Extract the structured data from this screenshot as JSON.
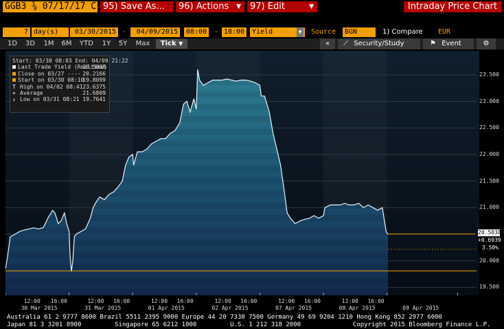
{
  "header": {
    "ticker": "GGB3 ⅜ 07/17/17 C",
    "save_label": "95) Save As...",
    "actions_label": "96) Actions",
    "edit_label": "97) Edit",
    "title": "Intraday Price Chart"
  },
  "params": {
    "period_value": "7",
    "period_unit": "day(s)",
    "start_date": "03/30/2015",
    "dash": "-",
    "end_date": "04/09/2015",
    "start_time": "08:00",
    "dash2": "-",
    "end_time": "18:00",
    "field": "Yield",
    "source_label": "Source",
    "source": "BGN",
    "compare_label": "1) Compare",
    "currency": "EUR"
  },
  "toolbar": {
    "tabs": [
      "1D",
      "3D",
      "1M",
      "6M",
      "YTD",
      "1Y",
      "5Y",
      "Max",
      "Tick"
    ],
    "active_tab": "Tick",
    "collapse": "«",
    "security_study": "Security/Study",
    "event": "Event",
    "settings_icon": "gear-icon"
  },
  "legend": {
    "header": "Start: 03/30 08:03 End: 04/09 21:22",
    "rows": [
      {
        "label": "Last Trade Yield (Realtime)",
        "value": "20.5038",
        "color": "#ffffff"
      },
      {
        "label": "Close on 03/27 ----",
        "value": "20.2166",
        "color": "#f2a000"
      },
      {
        "label": "Start on 03/30 08:10",
        "value": "19.8099",
        "color": "#f2a000"
      },
      {
        "label": "High on 04/02 08:41",
        "value": "23.6375",
        "color": "#ffffff"
      },
      {
        "label": "Average",
        "value": "21.6809",
        "color": "#ffffff"
      },
      {
        "label": "Low on 03/31 08:21",
        "value": "19.7641",
        "color": "#ffffff"
      }
    ]
  },
  "price_tags": {
    "last": "20.5038",
    "change": "+0.6939",
    "pct": "3.50%"
  },
  "chart_data": {
    "type": "area",
    "y_ticks": [
      19.5,
      20.0,
      20.5,
      21.0,
      21.5,
      22.0,
      22.5,
      23.0,
      23.5
    ],
    "y_tick_labels": [
      "19.500",
      "20.000",
      "20.500",
      "21.000",
      "21.500",
      "22.000",
      "22.500",
      "23.000",
      "23.500"
    ],
    "ylim": [
      19.35,
      23.95
    ],
    "x_time_labels": [
      {
        "pos": 0.055,
        "text": "12:00"
      },
      {
        "pos": 0.112,
        "text": "16:00"
      },
      {
        "pos": 0.19,
        "text": "12:00"
      },
      {
        "pos": 0.245,
        "text": "16:00"
      },
      {
        "pos": 0.325,
        "text": "12:00"
      },
      {
        "pos": 0.38,
        "text": "16:00"
      },
      {
        "pos": 0.46,
        "text": "12:00"
      },
      {
        "pos": 0.515,
        "text": "16:00"
      },
      {
        "pos": 0.595,
        "text": "12:00"
      },
      {
        "pos": 0.65,
        "text": "16:00"
      },
      {
        "pos": 0.73,
        "text": "12:00"
      },
      {
        "pos": 0.785,
        "text": "16:00"
      }
    ],
    "x_day_labels": [
      {
        "pos": 0.065,
        "text": "30 Mar 2015"
      },
      {
        "pos": 0.2,
        "text": "31 Mar 2015"
      },
      {
        "pos": 0.335,
        "text": "01 Apr 2015"
      },
      {
        "pos": 0.47,
        "text": "02 Apr 2015"
      },
      {
        "pos": 0.605,
        "text": "07 Apr 2015"
      },
      {
        "pos": 0.74,
        "text": "08 Apr 2015"
      },
      {
        "pos": 0.875,
        "text": "09 Apr 2015"
      }
    ],
    "day_bounds": [
      0.0,
      0.135,
      0.27,
      0.405,
      0.54,
      0.675,
      0.81,
      0.96
    ],
    "series": [
      {
        "values": [
          [
            0.0,
            19.85
          ],
          [
            0.004,
            20.05
          ],
          [
            0.01,
            20.45
          ],
          [
            0.02,
            20.5
          ],
          [
            0.03,
            20.55
          ],
          [
            0.04,
            20.58
          ],
          [
            0.05,
            20.6
          ],
          [
            0.06,
            20.62
          ],
          [
            0.07,
            20.6
          ],
          [
            0.08,
            20.62
          ],
          [
            0.09,
            20.8
          ],
          [
            0.1,
            20.95
          ],
          [
            0.105,
            20.9
          ],
          [
            0.112,
            20.7
          ],
          [
            0.118,
            20.75
          ],
          [
            0.125,
            20.9
          ],
          [
            0.13,
            20.7
          ],
          [
            0.135,
            20.55
          ],
          [
            0.137,
            20.1
          ],
          [
            0.14,
            19.8
          ],
          [
            0.143,
            20.0
          ],
          [
            0.146,
            20.45
          ],
          [
            0.15,
            20.5
          ],
          [
            0.16,
            20.55
          ],
          [
            0.17,
            20.6
          ],
          [
            0.18,
            20.8
          ],
          [
            0.186,
            21.0
          ],
          [
            0.192,
            21.1
          ],
          [
            0.2,
            21.2
          ],
          [
            0.21,
            21.15
          ],
          [
            0.22,
            21.25
          ],
          [
            0.23,
            21.3
          ],
          [
            0.24,
            21.4
          ],
          [
            0.248,
            21.5
          ],
          [
            0.255,
            21.8
          ],
          [
            0.262,
            21.95
          ],
          [
            0.27,
            22.0
          ],
          [
            0.272,
            21.8
          ],
          [
            0.28,
            22.05
          ],
          [
            0.29,
            22.05
          ],
          [
            0.3,
            22.1
          ],
          [
            0.31,
            22.2
          ],
          [
            0.32,
            22.25
          ],
          [
            0.33,
            22.3
          ],
          [
            0.34,
            22.3
          ],
          [
            0.35,
            22.4
          ],
          [
            0.36,
            22.45
          ],
          [
            0.37,
            22.6
          ],
          [
            0.378,
            22.95
          ],
          [
            0.385,
            23.0
          ],
          [
            0.392,
            22.8
          ],
          [
            0.4,
            23.05
          ],
          [
            0.405,
            22.85
          ],
          [
            0.408,
            23.6
          ],
          [
            0.412,
            23.4
          ],
          [
            0.42,
            23.3
          ],
          [
            0.43,
            23.35
          ],
          [
            0.44,
            23.4
          ],
          [
            0.45,
            23.4
          ],
          [
            0.46,
            23.4
          ],
          [
            0.47,
            23.42
          ],
          [
            0.48,
            23.4
          ],
          [
            0.49,
            23.38
          ],
          [
            0.5,
            23.4
          ],
          [
            0.51,
            23.4
          ],
          [
            0.52,
            23.38
          ],
          [
            0.53,
            23.35
          ],
          [
            0.54,
            23.3
          ],
          [
            0.543,
            23.1
          ],
          [
            0.55,
            23.1
          ],
          [
            0.56,
            22.8
          ],
          [
            0.568,
            22.4
          ],
          [
            0.576,
            22.1
          ],
          [
            0.584,
            21.8
          ],
          [
            0.592,
            21.3
          ],
          [
            0.598,
            20.9
          ],
          [
            0.605,
            20.8
          ],
          [
            0.615,
            20.7
          ],
          [
            0.625,
            20.75
          ],
          [
            0.635,
            20.78
          ],
          [
            0.645,
            20.8
          ],
          [
            0.655,
            20.85
          ],
          [
            0.665,
            20.8
          ],
          [
            0.675,
            20.85
          ],
          [
            0.678,
            21.0
          ],
          [
            0.69,
            21.05
          ],
          [
            0.7,
            21.05
          ],
          [
            0.71,
            21.05
          ],
          [
            0.72,
            21.08
          ],
          [
            0.73,
            21.05
          ],
          [
            0.74,
            21.05
          ],
          [
            0.75,
            21.08
          ],
          [
            0.76,
            21.0
          ],
          [
            0.77,
            21.05
          ],
          [
            0.78,
            21.0
          ],
          [
            0.79,
            20.95
          ],
          [
            0.8,
            21.0
          ],
          [
            0.808,
            20.55
          ],
          [
            0.812,
            20.5
          ]
        ]
      }
    ],
    "reference_lines": [
      {
        "name": "last",
        "value": 20.5038,
        "color": "#f2a000"
      },
      {
        "name": "close",
        "value": 20.2166,
        "color": "#f2a000",
        "dashed": true
      },
      {
        "name": "start",
        "value": 19.8099,
        "color": "#f2a000"
      }
    ]
  },
  "footer": {
    "line1": "Australia 61 2 9777 8600 Brazil 5511 2395 9000 Europe 44 20 7330 7500 Germany 49 69 9204 1210 Hong Kong 852 2977 6000",
    "line2": "Japan 81 3 3201 8900         Singapore 65 6212 1000         U.S. 1 212 318 2000              Copyright 2015 Bloomberg Finance L.P."
  }
}
